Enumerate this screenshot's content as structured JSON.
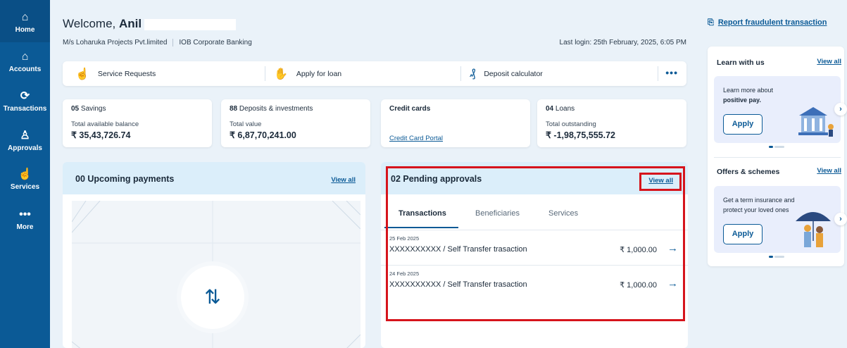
{
  "sidebar": {
    "items": [
      {
        "label": "Home",
        "icon": "home-icon",
        "glyph": "⌂"
      },
      {
        "label": "Accounts",
        "icon": "bank-icon",
        "glyph": "⌂"
      },
      {
        "label": "Transactions",
        "icon": "transfer-icon",
        "glyph": "⟳"
      },
      {
        "label": "Approvals",
        "icon": "approval-icon",
        "glyph": "♙"
      },
      {
        "label": "Services",
        "icon": "hand-icon",
        "glyph": "☝"
      },
      {
        "label": "More",
        "icon": "more-icon",
        "glyph": "•••"
      }
    ]
  },
  "header": {
    "welcome_prefix": "Welcome,",
    "user_name": "Anil",
    "company": "M/s Loharuka Projects Pvt.limited",
    "bank_type": "IOB Corporate Banking",
    "last_login": "Last login: 25th February, 2025, 6:05 PM"
  },
  "quick_actions": [
    {
      "label": "Service Requests",
      "icon": "service-request-icon",
      "glyph": "☝"
    },
    {
      "label": "Apply for loan",
      "icon": "loan-icon",
      "glyph": "✋"
    },
    {
      "label": "Deposit calculator",
      "icon": "money-bag-icon",
      "glyph": "₰"
    }
  ],
  "quick_more": "•••",
  "accounts": {
    "savings": {
      "count": "05",
      "title": "Savings",
      "sub": "Total available balance",
      "value": "₹ 35,43,726.74"
    },
    "deposits": {
      "count": "88",
      "title": "Deposits & investments",
      "sub": "Total value",
      "value": "₹ 6,87,70,241.00"
    },
    "credit": {
      "title": "Credit cards",
      "link": "Credit Card Portal"
    },
    "loans": {
      "count": "04",
      "title": "Loans",
      "sub": "Total outstanding",
      "value": "₹ -1,98,75,555.72"
    }
  },
  "upcoming": {
    "title": "00 Upcoming payments",
    "view_all": "View all",
    "icon_glyph": "⇅"
  },
  "approvals": {
    "title": "02 Pending approvals",
    "view_all": "View all",
    "tabs": [
      "Transactions",
      "Beneficiaries",
      "Services"
    ],
    "items": [
      {
        "date": "25 Feb 2025",
        "desc": "XXXXXXXXXX / Self Transfer trasaction",
        "amount": "₹ 1,000.00"
      },
      {
        "date": "24 Feb 2025",
        "desc": "XXXXXXXXXX / Self Transfer trasaction",
        "amount": "₹ 1,000.00"
      }
    ]
  },
  "right": {
    "report": "Report fraudulent transaction",
    "learn_title": "Learn with us",
    "learn_view_all": "View all",
    "learn_text": "Learn more about",
    "learn_bold": "positive pay.",
    "learn_apply": "Apply",
    "offers_title": "Offers & schemes",
    "offers_view_all": "View all",
    "offers_text": "Get a term insurance and protect your loved ones",
    "offers_apply": "Apply"
  },
  "colors": {
    "primary": "#0b5a96",
    "highlight": "#d6141c",
    "bg": "#eaf2f9"
  }
}
